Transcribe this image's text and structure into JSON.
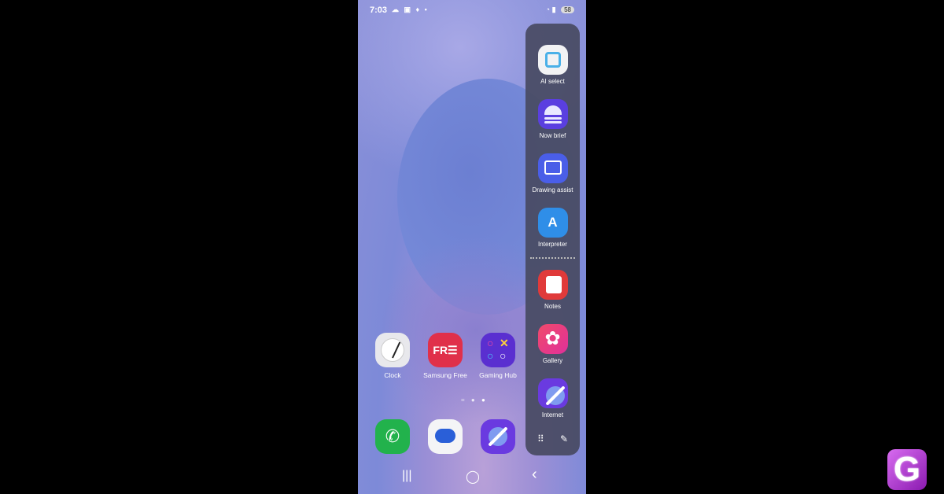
{
  "status_bar": {
    "time": "7:03",
    "icons_left": [
      "cloud-icon",
      "image-icon",
      "bulb-icon",
      "dot-icon"
    ],
    "icons_right": [
      "wifi-icon",
      "signal-icon"
    ],
    "battery": "58"
  },
  "home_apps": [
    {
      "label": "Clock",
      "icon": "clock-icon"
    },
    {
      "label": "Samsung Free",
      "icon": "samsung-free-icon",
      "glyph": "FR☰"
    },
    {
      "label": "Gaming Hub",
      "icon": "gaming-hub-icon"
    }
  ],
  "dock_apps": [
    {
      "label": "",
      "icon": "phone-icon"
    },
    {
      "label": "",
      "icon": "messages-icon"
    },
    {
      "label": "",
      "icon": "internet-icon"
    }
  ],
  "edge_panel": {
    "ai_apps": [
      {
        "label": "AI select",
        "icon": "ai-select-icon"
      },
      {
        "label": "Now brief",
        "icon": "now-brief-icon"
      },
      {
        "label": "Drawing assist",
        "icon": "drawing-assist-icon"
      },
      {
        "label": "Interpreter",
        "icon": "interpreter-icon",
        "glyph": "A"
      }
    ],
    "apps": [
      {
        "label": "Notes",
        "icon": "notes-icon"
      },
      {
        "label": "Gallery",
        "icon": "gallery-icon"
      },
      {
        "label": "Internet",
        "icon": "internet-icon"
      }
    ]
  },
  "navigation": {
    "recents": "|||",
    "home": "◯",
    "back": "‹"
  },
  "watermark": "G"
}
